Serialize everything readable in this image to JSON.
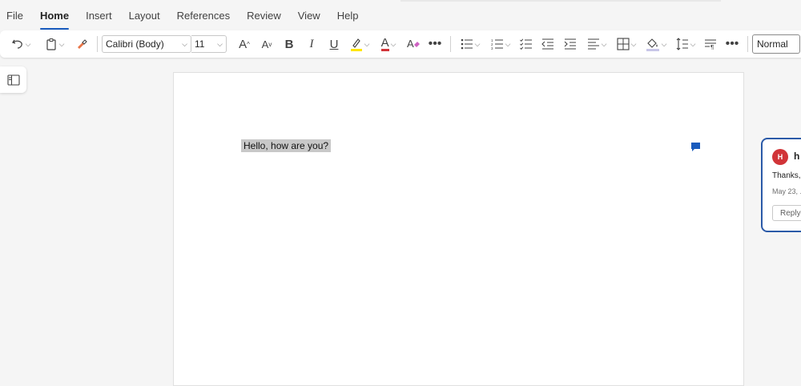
{
  "menu": {
    "tabs": [
      {
        "label": "File"
      },
      {
        "label": "Home"
      },
      {
        "label": "Insert"
      },
      {
        "label": "Layout"
      },
      {
        "label": "References"
      },
      {
        "label": "Review"
      },
      {
        "label": "View"
      },
      {
        "label": "Help"
      }
    ]
  },
  "toolbar": {
    "font_name": "Calibri (Body)",
    "font_size": "11",
    "grow_font_label": "A",
    "shrink_font_label": "A",
    "bold_label": "B",
    "italic_label": "I",
    "underline_label": "U",
    "font_color_label": "A",
    "style_value": "Normal",
    "highlight_color": "#ffe600",
    "font_color": "#d13438"
  },
  "document": {
    "text": "Hello, how are you?"
  },
  "comment": {
    "avatar_initial": "H",
    "author": "h",
    "text": "Thanks,",
    "date": "May 23, ...",
    "reply_label": "Reply"
  }
}
